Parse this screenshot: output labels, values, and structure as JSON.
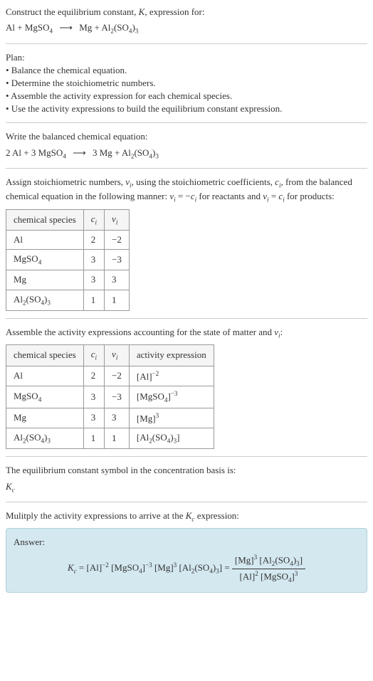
{
  "prompt": {
    "line1_prefix": "Construct the equilibrium constant, ",
    "line1_K": "K",
    "line1_suffix": ", expression for:",
    "eq_left1": "Al + MgSO",
    "eq_left1_sub": "4",
    "eq_right1_a": "Mg + Al",
    "eq_right1_sub1": "2",
    "eq_right1_b": "(SO",
    "eq_right1_sub2": "4",
    "eq_right1_c": ")",
    "eq_right1_sub3": "3"
  },
  "plan": {
    "header": "Plan:",
    "item1": "• Balance the chemical equation.",
    "item2": "• Determine the stoichiometric numbers.",
    "item3": "• Assemble the activity expression for each chemical species.",
    "item4": "• Use the activity expressions to build the equilibrium constant expression."
  },
  "balanced": {
    "intro": "Write the balanced chemical equation:",
    "left_a": "2 Al + 3 MgSO",
    "left_sub": "4",
    "right_a": "3 Mg + Al",
    "right_sub1": "2",
    "right_b": "(SO",
    "right_sub2": "4",
    "right_c": ")",
    "right_sub3": "3"
  },
  "stoich": {
    "intro_a": "Assign stoichiometric numbers, ",
    "nu_i": "ν",
    "i_sub": "i",
    "intro_b": ", using the stoichiometric coefficients, ",
    "c_i": "c",
    "intro_c": ", from the balanced chemical equation in the following manner: ",
    "rel1_a": "ν",
    "rel1_b": " = −",
    "rel1_c": "c",
    "intro_d": " for reactants and ",
    "rel2_a": "ν",
    "rel2_b": " = ",
    "rel2_c": "c",
    "intro_e": " for products:",
    "hdr_species": "chemical species",
    "hdr_ci": "c",
    "hdr_nui": "ν",
    "rows": [
      {
        "species": "Al",
        "ci": "2",
        "nui": "−2"
      },
      {
        "species_a": "MgSO",
        "species_sub": "4",
        "ci": "3",
        "nui": "−3"
      },
      {
        "species": "Mg",
        "ci": "3",
        "nui": "3"
      },
      {
        "species_a": "Al",
        "species_sub1": "2",
        "species_b": "(SO",
        "species_sub2": "4",
        "species_c": ")",
        "species_sub3": "3",
        "ci": "1",
        "nui": "1"
      }
    ]
  },
  "activity": {
    "intro_a": "Assemble the activity expressions accounting for the state of matter and ",
    "nu_i": "ν",
    "i_sub": "i",
    "intro_b": ":",
    "hdr_species": "chemical species",
    "hdr_ci": "c",
    "hdr_nui": "ν",
    "hdr_act": "activity expression",
    "rows": [
      {
        "species": "Al",
        "ci": "2",
        "nui": "−2",
        "act_a": "[Al]",
        "act_sup": "−2"
      },
      {
        "species_a": "MgSO",
        "species_sub": "4",
        "ci": "3",
        "nui": "−3",
        "act_a": "[MgSO",
        "act_sub": "4",
        "act_b": "]",
        "act_sup": "−3"
      },
      {
        "species": "Mg",
        "ci": "3",
        "nui": "3",
        "act_a": "[Mg]",
        "act_sup": "3"
      },
      {
        "species_a": "Al",
        "species_sub1": "2",
        "species_b": "(SO",
        "species_sub2": "4",
        "species_c": ")",
        "species_sub3": "3",
        "ci": "1",
        "nui": "1",
        "act_a": "[Al",
        "act_sub1": "2",
        "act_b": "(SO",
        "act_sub2": "4",
        "act_c": ")",
        "act_sub3": "3",
        "act_d": "]"
      }
    ]
  },
  "symbol": {
    "intro": "The equilibrium constant symbol in the concentration basis is:",
    "K": "K",
    "c_sub": "c"
  },
  "multiply": {
    "intro_a": "Mulitply the activity expressions to arrive at the ",
    "K": "K",
    "c_sub": "c",
    "intro_b": " expression:"
  },
  "answer": {
    "label": "Answer:",
    "K": "K",
    "c_sub": "c",
    "eq": " = [Al]",
    "sup1": "−2",
    "m1": " [MgSO",
    "sub1": "4",
    "m1b": "]",
    "sup2": "−3",
    "m2": " [Mg]",
    "sup3": "3",
    "m3": " [Al",
    "sub2": "2",
    "m3b": "(SO",
    "sub3": "4",
    "m3c": ")",
    "sub4": "3",
    "m3d": "] = ",
    "num_a": "[Mg]",
    "num_sup1": "3",
    "num_b": " [Al",
    "num_sub1": "2",
    "num_c": "(SO",
    "num_sub2": "4",
    "num_d": ")",
    "num_sub3": "3",
    "num_e": "]",
    "den_a": "[Al]",
    "den_sup1": "2",
    "den_b": " [MgSO",
    "den_sub1": "4",
    "den_c": "]",
    "den_sup2": "3"
  },
  "arrow": "⟶"
}
